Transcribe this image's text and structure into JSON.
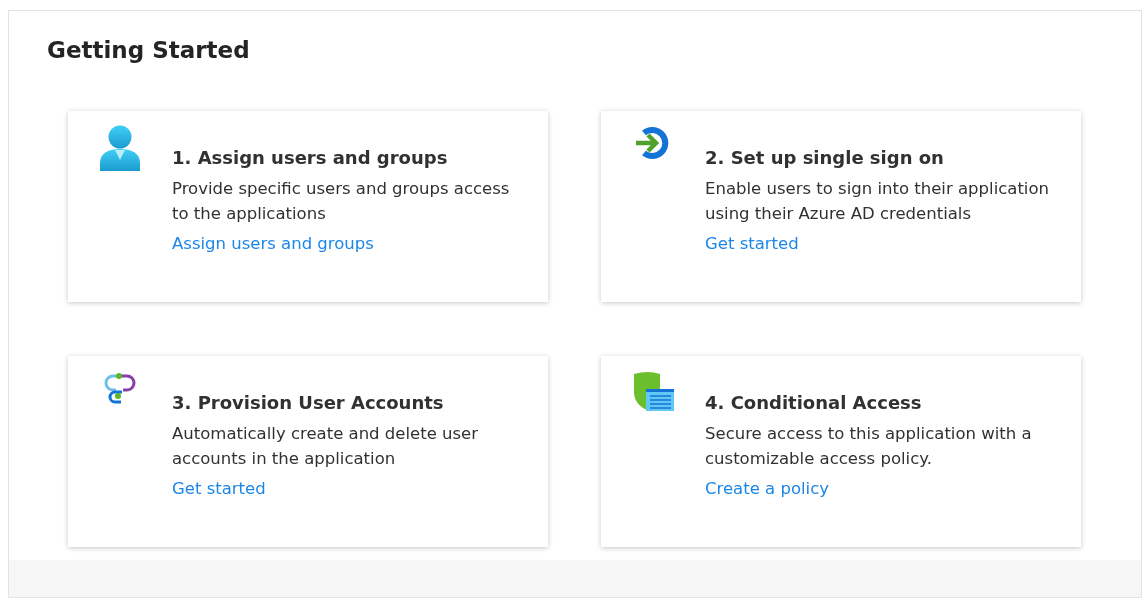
{
  "title": "Getting Started",
  "cards": [
    {
      "kind": "user",
      "title": "1. Assign users and groups",
      "description": "Provide specific users and groups access to the applications",
      "link": "Assign users and groups"
    },
    {
      "kind": "signin",
      "title": "2. Set up single sign on",
      "description": "Enable users to sign into their application using their Azure AD credentials",
      "link": "Get started"
    },
    {
      "kind": "provision",
      "title": "3. Provision User Accounts",
      "description": "Automatically create and delete user accounts in the application",
      "link": "Get started"
    },
    {
      "kind": "policy",
      "title": "4. Conditional Access",
      "description": "Secure access to this application with a customizable access policy.",
      "link": "Create a policy"
    }
  ]
}
